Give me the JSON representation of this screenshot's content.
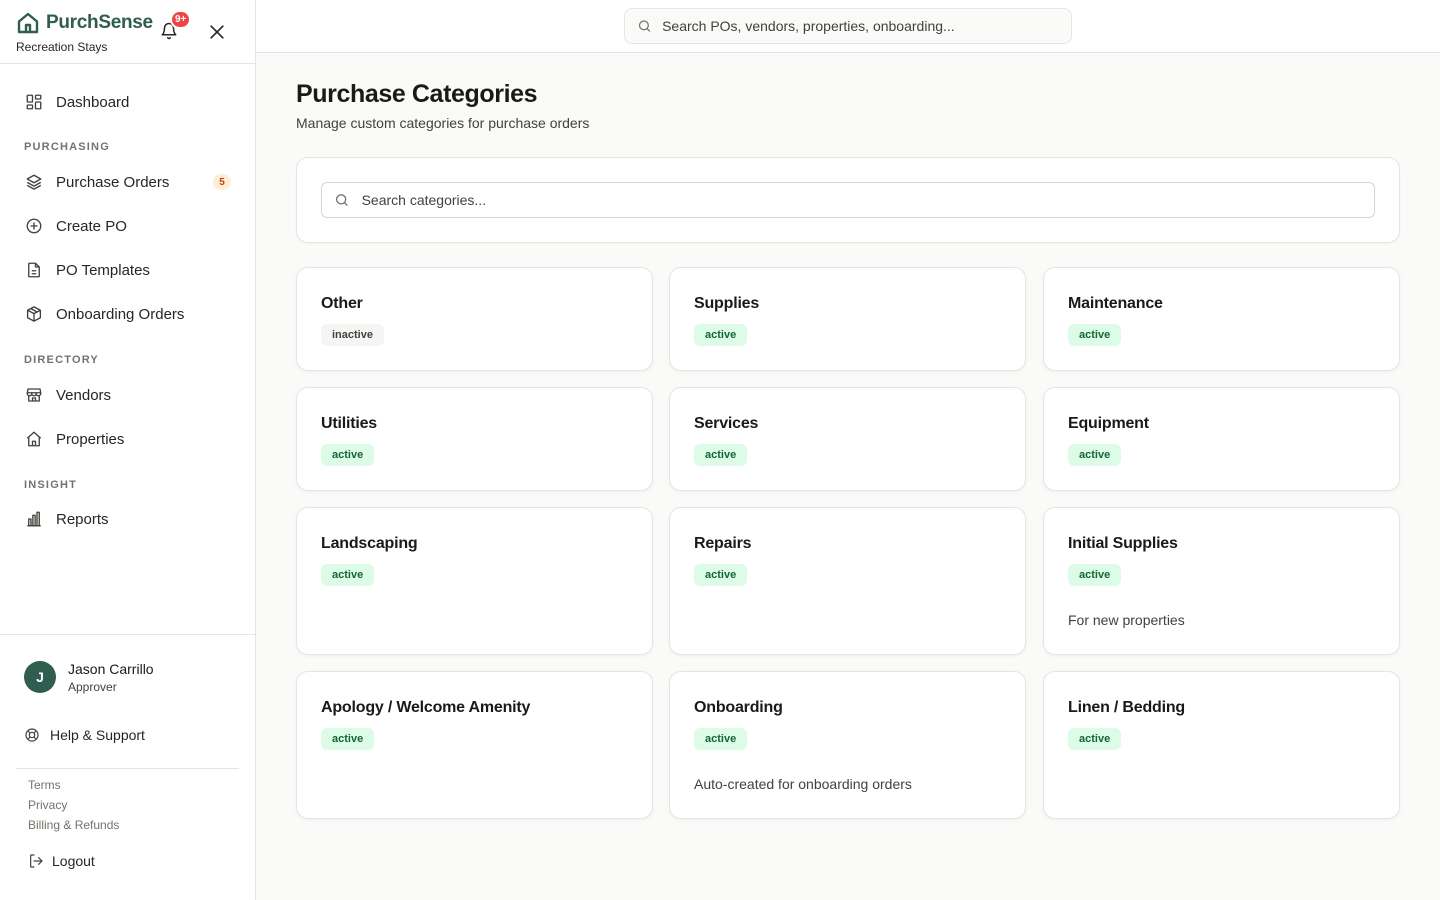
{
  "brand": {
    "name": "PurchSense",
    "org": "Recreation Stays",
    "notifications": "9+"
  },
  "search": {
    "placeholder": "Search POs, vendors, properties, onboarding..."
  },
  "nav": {
    "dashboard": "Dashboard",
    "sections": {
      "purchasing": "PURCHASING",
      "directory": "DIRECTORY",
      "insight": "INSIGHT"
    },
    "purchase_orders": "Purchase Orders",
    "purchase_orders_count": "5",
    "create_po": "Create PO",
    "po_templates": "PO Templates",
    "onboarding_orders": "Onboarding Orders",
    "vendors": "Vendors",
    "properties": "Properties",
    "reports": "Reports"
  },
  "user": {
    "initial": "J",
    "name": "Jason Carrillo",
    "role": "Approver"
  },
  "footer": {
    "help": "Help & Support",
    "terms": "Terms",
    "privacy": "Privacy",
    "billing": "Billing & Refunds",
    "logout": "Logout"
  },
  "page": {
    "title": "Purchase Categories",
    "subtitle": "Manage custom categories for purchase orders",
    "search_placeholder": "Search categories..."
  },
  "categories": [
    {
      "name": "Other",
      "status": "inactive",
      "description": ""
    },
    {
      "name": "Supplies",
      "status": "active",
      "description": ""
    },
    {
      "name": "Maintenance",
      "status": "active",
      "description": ""
    },
    {
      "name": "Utilities",
      "status": "active",
      "description": ""
    },
    {
      "name": "Services",
      "status": "active",
      "description": ""
    },
    {
      "name": "Equipment",
      "status": "active",
      "description": ""
    },
    {
      "name": "Landscaping",
      "status": "active",
      "description": ""
    },
    {
      "name": "Repairs",
      "status": "active",
      "description": ""
    },
    {
      "name": "Initial Supplies",
      "status": "active",
      "description": "For new properties"
    },
    {
      "name": "Apology / Welcome Amenity",
      "status": "active",
      "description": ""
    },
    {
      "name": "Onboarding",
      "status": "active",
      "description": "Auto-created for onboarding orders"
    },
    {
      "name": "Linen / Bedding",
      "status": "active",
      "description": ""
    }
  ],
  "colors": {
    "brand": "#2f5d4f",
    "active_bg": "#dcfce7",
    "active_text": "#166534",
    "badge": "#ef4444"
  }
}
